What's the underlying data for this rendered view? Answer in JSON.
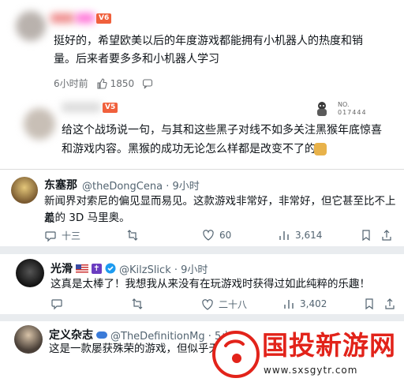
{
  "comment1": {
    "level_badge": "V6",
    "text_line1": "挺好的，希望欧美以后的年度游戏都能拥有小机器人的热度和销",
    "text_line2": "量。后来者要多多和小机器人学习",
    "time": "6小时前",
    "likes": "1850"
  },
  "comment2": {
    "level_badge": "V5",
    "fan_no_label": "NO.",
    "fan_no_value": "017444",
    "text_line1": "给这个战场说一句，与其和这些黑子对线不如多关注黑猴年底惊喜",
    "text_line2": "和游戏内容。黑猴的成功无论怎么样都是改变不了的。"
  },
  "tweet1": {
    "name": "东塞那",
    "handle": "@theDongCena · 9小时",
    "text_line1": "新闻界对索尼的偏见显而易见。这款游戏非常好，非常好，但它甚至比不上最",
    "text_line2": "差的 3D 马里奥。",
    "replies": "十三",
    "likes": "60",
    "views": "3,614"
  },
  "tweet2": {
    "name": "光滑",
    "handle": "@KilzSlick · 9小时",
    "text": "这真是太棒了！我想我从来没有在玩游戏时获得过如此纯粹的乐趣！",
    "likes": "二十八",
    "views": "3,402"
  },
  "tweet3": {
    "name": "定义杂志",
    "handle": "@TheDefinitionMg · 5小",
    "text": "这是一款屡获殊荣的游戏，但似乎无"
  },
  "watermark": {
    "title": "国投新游网",
    "url": "www.sxsgytr.com"
  },
  "colors": {
    "brand_red": "#e2231a",
    "verified_blue": "#1d9bf0",
    "badge_orange": "#f0603c"
  }
}
